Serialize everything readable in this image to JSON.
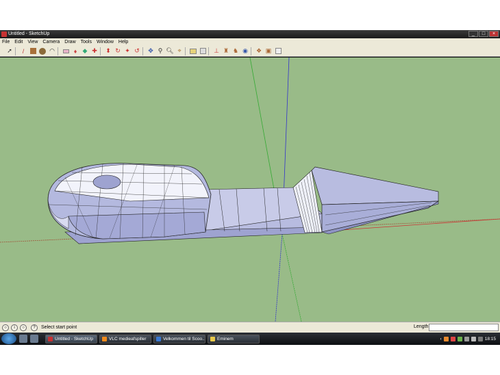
{
  "window": {
    "title": "Untitled - SketchUp",
    "controls": [
      "minimize",
      "maximize",
      "close"
    ]
  },
  "menu": [
    "File",
    "Edit",
    "View",
    "Camera",
    "Draw",
    "Tools",
    "Window",
    "Help"
  ],
  "toolbar": {
    "icons": [
      "select-icon",
      "pencil-line-icon",
      "rectangle-icon",
      "circle-icon",
      "arc-icon",
      "eraser-icon",
      "paint-bucket-icon",
      "follow-me-icon",
      "move-icon",
      "push-pull-icon",
      "rotate-icon",
      "offset-icon",
      "orbit-icon",
      "pan-icon",
      "zoom-icon",
      "zoom-extents-icon",
      "tape-measure-icon",
      "dimension-icon",
      "text-icon",
      "axes-icon",
      "3d-text-icon",
      "walk-icon",
      "section-plane-icon",
      "components-icon"
    ]
  },
  "viewport": {
    "background": "#99bb88",
    "axes": {
      "red": "#cc3333",
      "green": "#33aa33",
      "blue": "#3333cc"
    },
    "model_fill": "#b8bce0",
    "model_edge": "#222222"
  },
  "statusbar": {
    "message": "Select start point",
    "length_label": "Length",
    "length_value": ""
  },
  "taskbar": {
    "tasks": [
      {
        "label": "Untitled - SketchUp",
        "color": "#c83232"
      },
      {
        "label": "VLC medieafspiller",
        "color": "#f08a1c"
      },
      {
        "label": "Velkommen til Scoo...",
        "color": "#3a78d0"
      },
      {
        "label": "Eminem",
        "color": "#e8c84a"
      }
    ],
    "clock": "18:15"
  }
}
